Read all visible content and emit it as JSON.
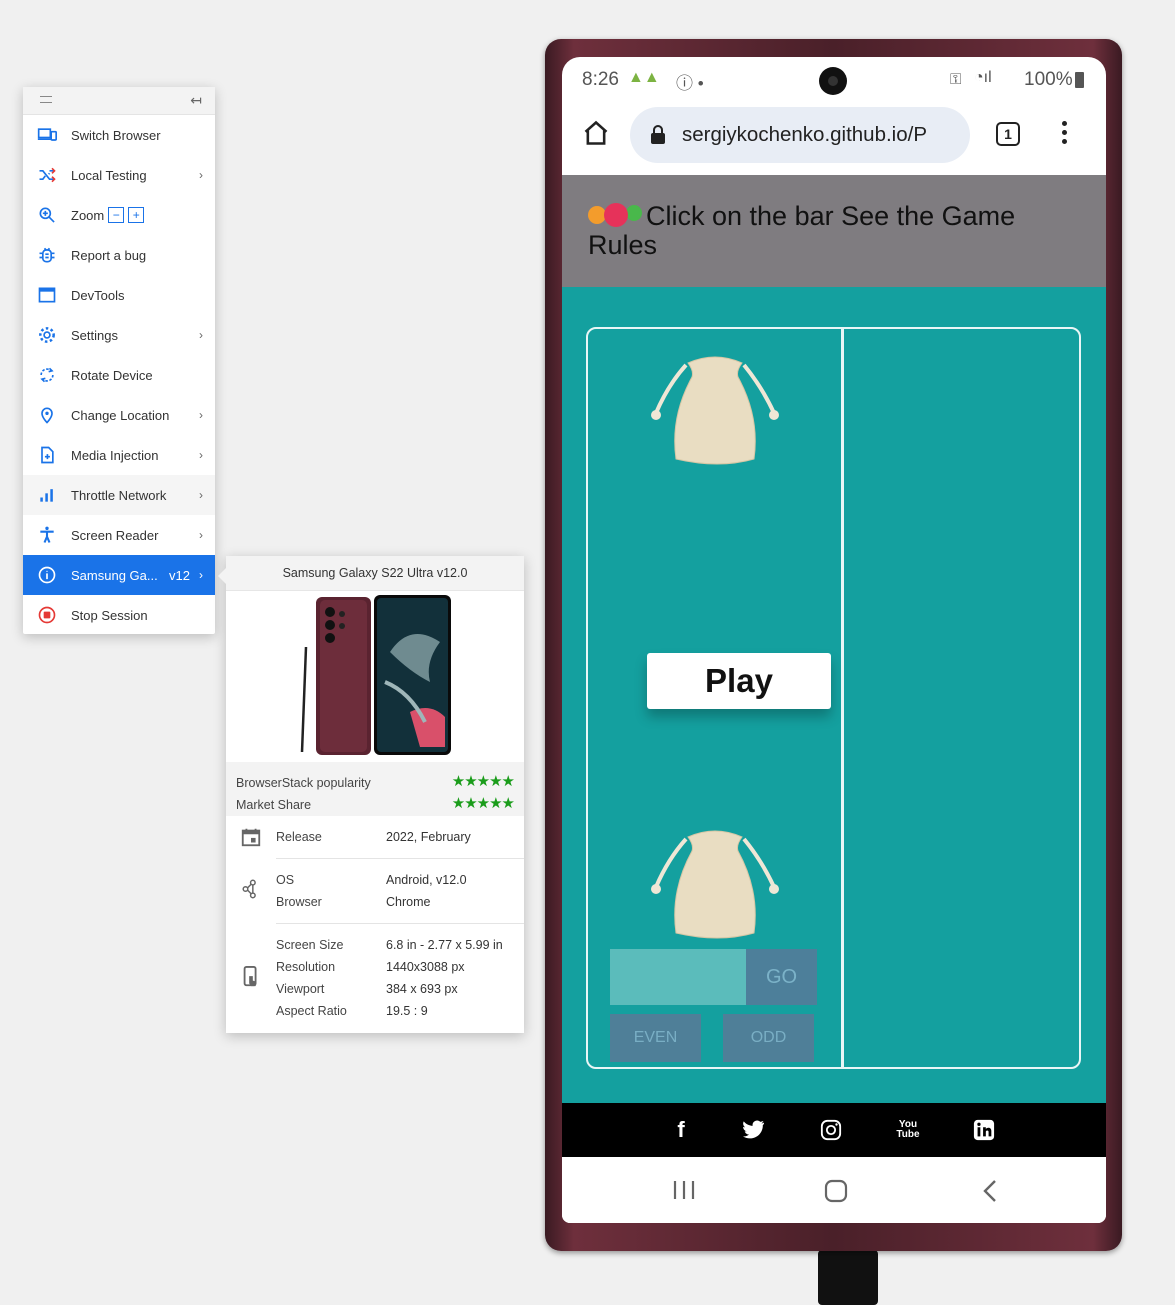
{
  "menu": {
    "items": [
      {
        "label": "Switch Browser",
        "icon": "devices-icon"
      },
      {
        "label": "Local Testing",
        "icon": "shuffle-icon",
        "has_submenu": true
      },
      {
        "label": "Zoom",
        "icon": "zoom-in-icon",
        "zoom_out": "−",
        "zoom_in": "+"
      },
      {
        "label": "Report a bug",
        "icon": "bug-icon"
      },
      {
        "label": "DevTools",
        "icon": "window-icon"
      },
      {
        "label": "Settings",
        "icon": "gear-icon",
        "has_submenu": true
      },
      {
        "label": "Rotate Device",
        "icon": "rotate-icon"
      },
      {
        "label": "Change Location",
        "icon": "location-pin-icon",
        "has_submenu": true
      },
      {
        "label": "Media Injection",
        "icon": "file-add-icon",
        "has_submenu": true
      },
      {
        "label": "Throttle Network",
        "icon": "signal-bars-icon",
        "has_submenu": true
      },
      {
        "label": "Screen Reader",
        "icon": "accessibility-icon",
        "has_submenu": true
      },
      {
        "label": "Samsung Ga...",
        "version": "v12",
        "icon": "info-icon",
        "has_submenu": true,
        "active": true
      },
      {
        "label": "Stop Session",
        "icon": "stop-icon"
      }
    ],
    "chevron": "›",
    "accent_color": "#1a73e8"
  },
  "device_popup": {
    "title": "Samsung Galaxy S22 Ultra v12.0",
    "popularity_label": "BrowserStack popularity",
    "market_share_label": "Market Share",
    "popularity_stars": 5,
    "market_share_stars": 5,
    "release_label": "Release",
    "release_value": "2022, February",
    "os_label": "OS",
    "os_value": "Android, v12.0",
    "browser_label": "Browser",
    "browser_value": "Chrome",
    "screen_size_label": "Screen Size",
    "screen_size_value": "6.8 in - 2.77 x 5.99 in",
    "resolution_label": "Resolution",
    "resolution_value": "1440x3088 px",
    "viewport_label": "Viewport",
    "viewport_value": "384 x 693 px",
    "aspect_label": "Aspect Ratio",
    "aspect_value": "19.5 : 9"
  },
  "phone": {
    "status": {
      "time": "8:26",
      "battery": "100%"
    },
    "url": "sergiykochenko.github.io/P",
    "tab_count": "1",
    "game": {
      "header_text": "Click on the bar See the Game Rules",
      "play_label": "Play",
      "go_label": "GO",
      "even_label": "EVEN",
      "odd_label": "ODD",
      "teal_color": "#14a09f"
    }
  }
}
